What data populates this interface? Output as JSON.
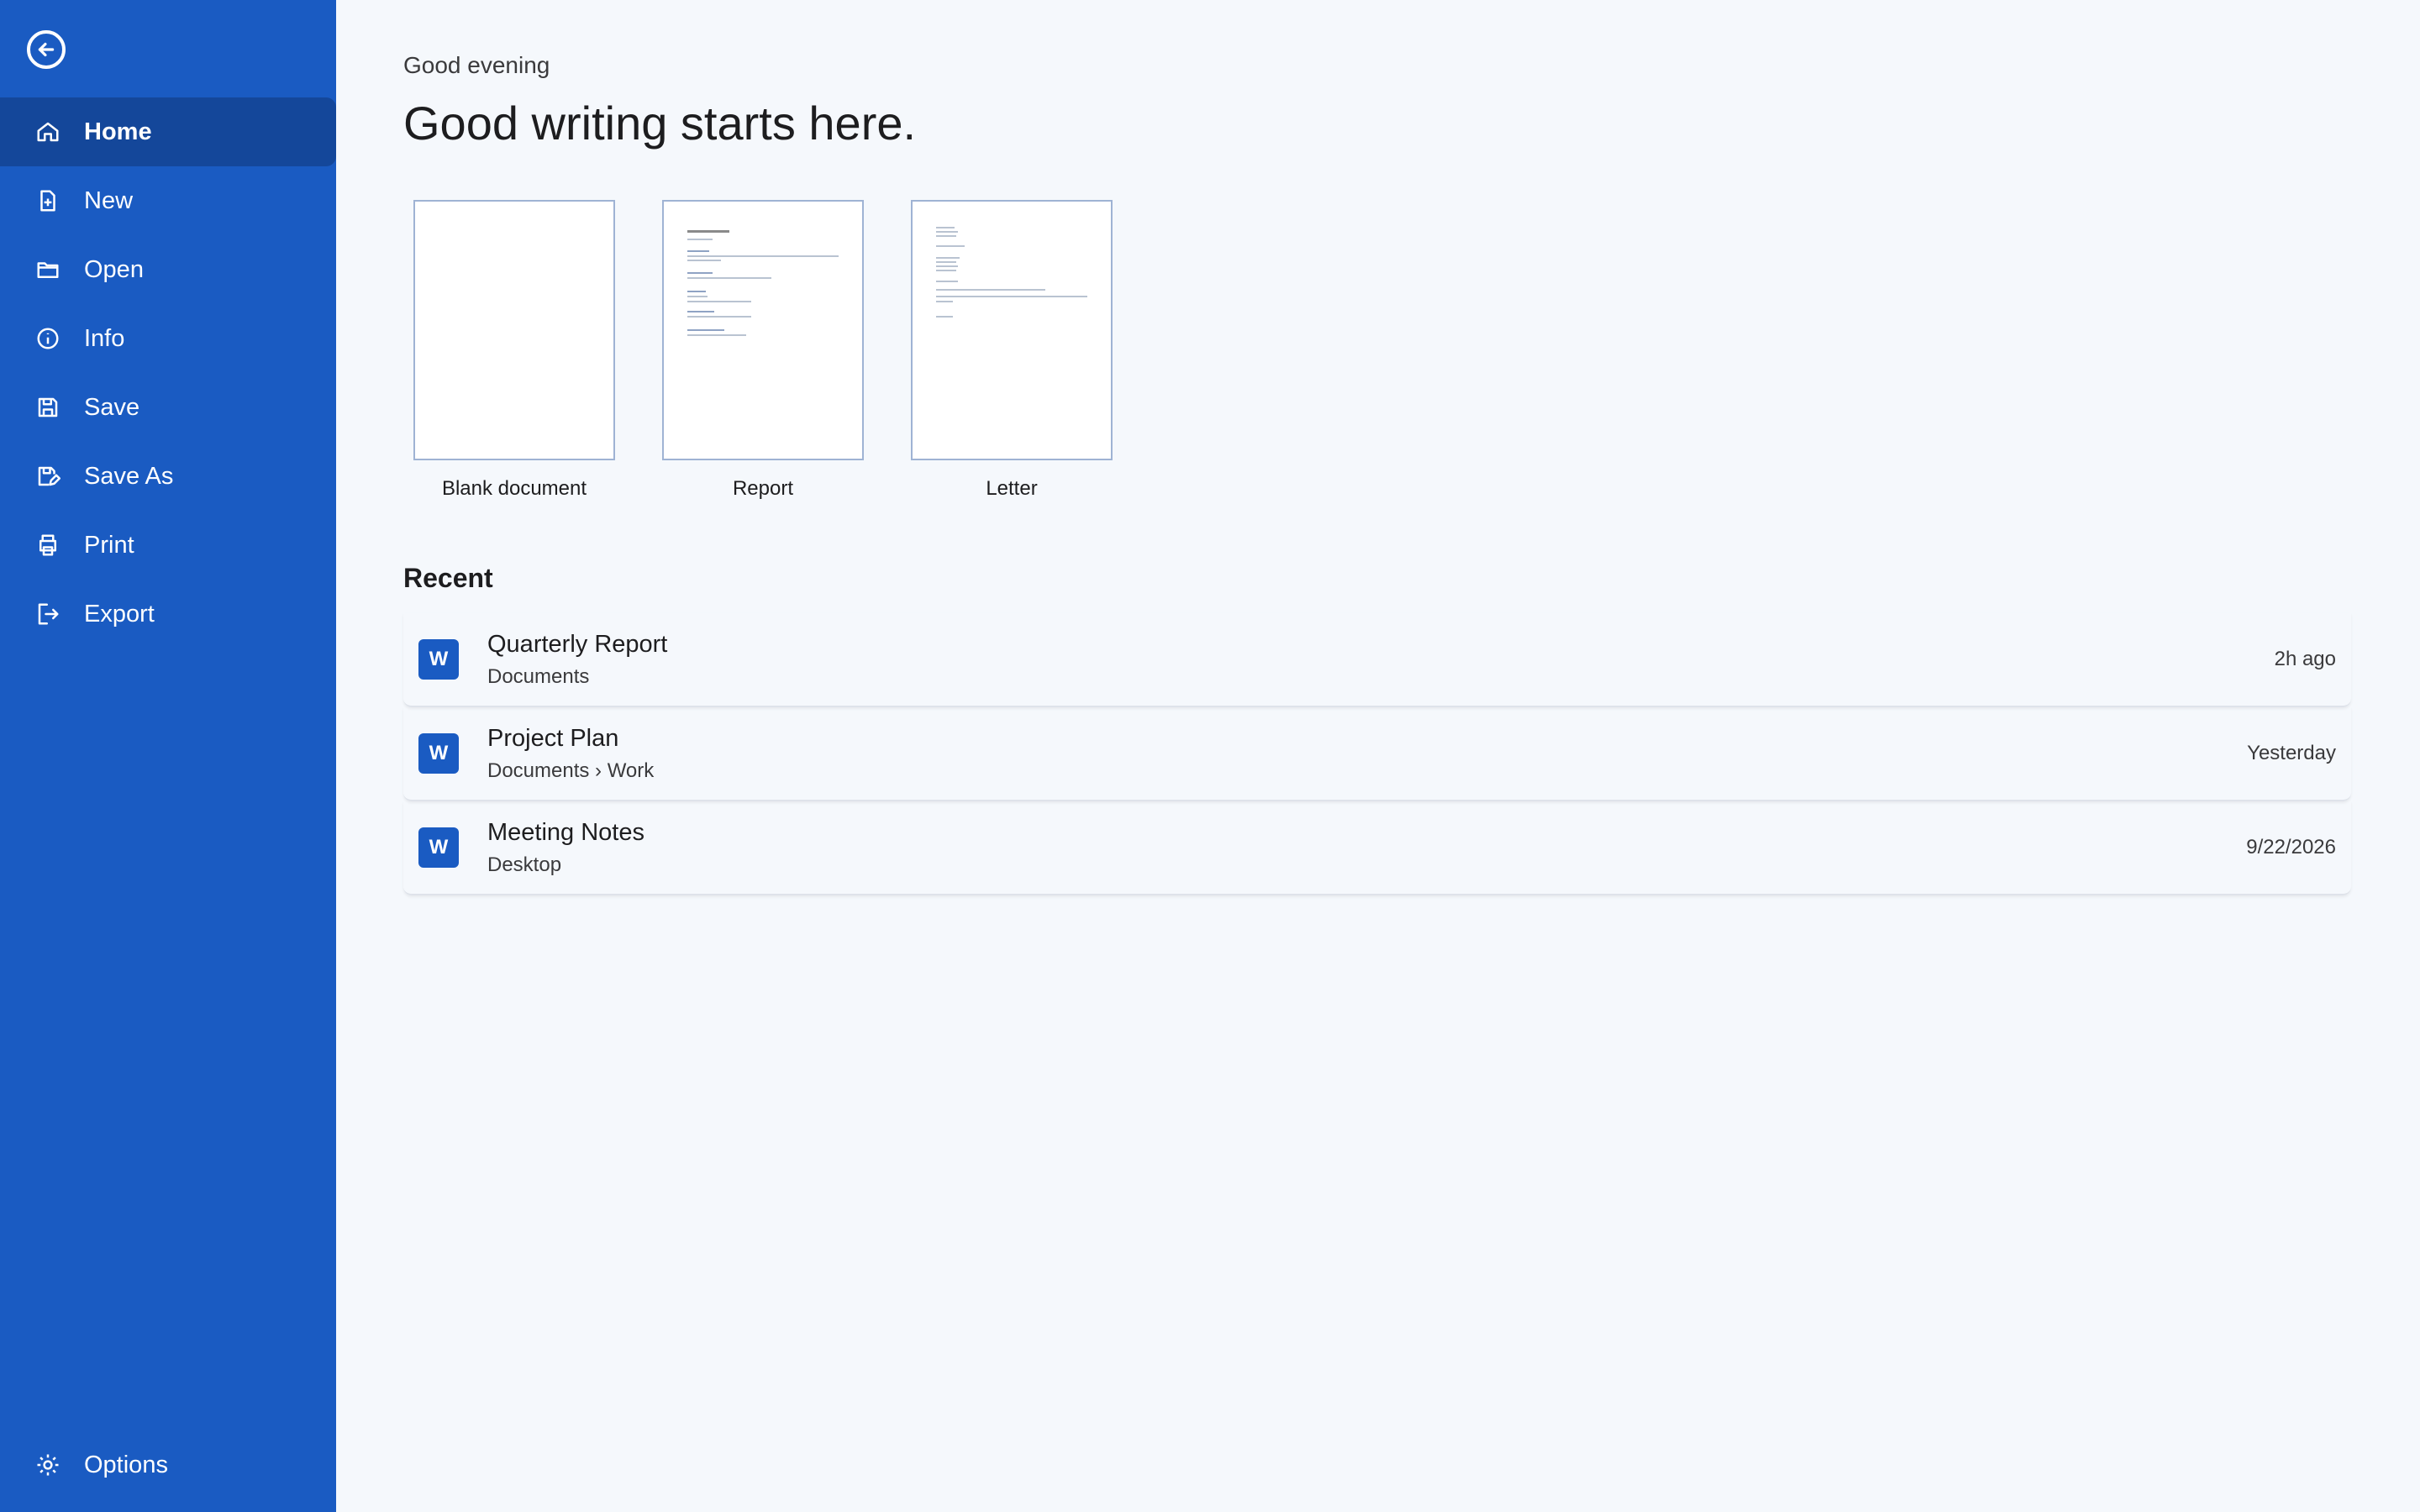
{
  "sidebar": {
    "back_icon": "arrow-left-circle-icon",
    "items": [
      {
        "label": "Home",
        "icon": "home-icon",
        "active": true
      },
      {
        "label": "New",
        "icon": "new-doc-icon"
      },
      {
        "label": "Open",
        "icon": "folder-icon"
      },
      {
        "label": "Info",
        "icon": "info-icon"
      },
      {
        "label": "Save",
        "icon": "save-icon"
      },
      {
        "label": "Save As",
        "icon": "save-as-icon"
      },
      {
        "label": "Print",
        "icon": "print-icon"
      },
      {
        "label": "Export",
        "icon": "export-icon"
      }
    ],
    "options": {
      "label": "Options",
      "icon": "gear-icon"
    }
  },
  "main": {
    "greeting": "Good evening",
    "headline": "Good writing starts here.",
    "templates": [
      {
        "label": "Blank document"
      },
      {
        "label": "Report"
      },
      {
        "label": "Letter"
      }
    ],
    "recent": {
      "title": "Recent",
      "items": [
        {
          "name": "Quarterly Report",
          "path": "Documents",
          "time": "2h ago",
          "icon_letter": "W"
        },
        {
          "name": "Project Plan",
          "path": "Documents › Work",
          "time": "Yesterday",
          "icon_letter": "W"
        },
        {
          "name": "Meeting Notes",
          "path": "Desktop",
          "time": "9/22/2026",
          "icon_letter": "W"
        }
      ]
    }
  },
  "colors": {
    "sidebar_bg": "#1a5bc2",
    "sidebar_active": "#14479a",
    "page_bg": "#f5f8fc",
    "word_icon": "#1a5bc2"
  }
}
